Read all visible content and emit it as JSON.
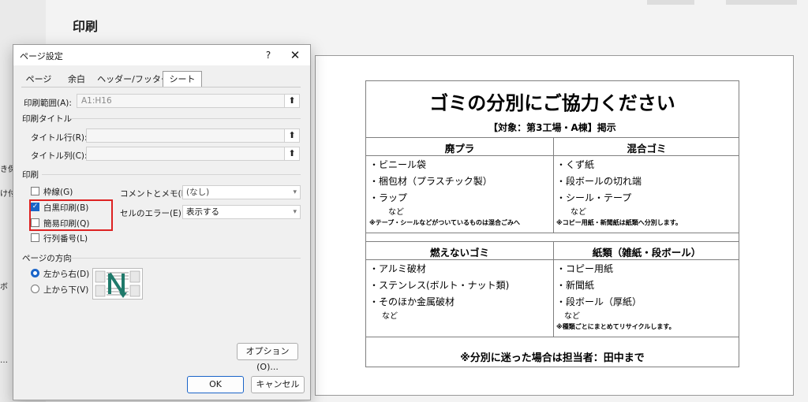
{
  "backstage": {
    "heading": "印刷",
    "edge_fragments": [
      "き保",
      "け付",
      "ボ",
      "…"
    ]
  },
  "dialog": {
    "title": "ページ設定",
    "help": "?",
    "close": "✕",
    "tabs": [
      "ページ",
      "余白",
      "ヘッダー/フッター",
      "シート"
    ],
    "active_tab": "シート",
    "print_area_label": "印刷範囲(A):",
    "print_area_value": "A1:H16",
    "print_titles_group": "印刷タイトル",
    "title_rows_label": "タイトル行(R):",
    "title_cols_label": "タイトル列(C):",
    "print_group": "印刷",
    "checkboxes": [
      {
        "label": "枠線(G)",
        "checked": false
      },
      {
        "label": "白黒印刷(B)",
        "checked": true
      },
      {
        "label": "簡易印刷(Q)",
        "checked": false
      },
      {
        "label": "行列番号(L)",
        "checked": false
      }
    ],
    "comments_label": "コメントとメモ(M):",
    "comments_value": "(なし)",
    "cell_errors_label": "セルのエラー(E):",
    "cell_errors_value": "表示する",
    "page_order_group": "ページの方向",
    "radio_down_then_over": "左から右(D)",
    "radio_over_then_down": "上から下(V)",
    "selected_order": "left_to_right",
    "options_button": "オプション(O)...",
    "ok_button": "OK",
    "cancel_button": "キャンセル",
    "accent_color": "#1a64c8",
    "highlight_color": "#dd2222",
    "up_arrow_icon": "⬆"
  },
  "sheet": {
    "title": "ゴミの分別にご協力ください",
    "subtitle": "【対象：第3工場・A棟】掲示",
    "categories": [
      {
        "name": "廃プラ",
        "items": [
          "・ビニール袋",
          "・梱包材（プラスチック製）",
          "・ラップ"
        ],
        "etc": "など",
        "note": "※テープ・シールなどがついているものは混合ごみへ"
      },
      {
        "name": "混合ゴミ",
        "items": [
          "・くず紙",
          "・段ボールの切れ端",
          "・シール・テープ"
        ],
        "etc": "など",
        "note": "※コピー用紙・新聞紙は紙類へ分別します。"
      },
      {
        "name": "燃えないゴミ",
        "items": [
          "・アルミ破材",
          "・ステンレス(ボルト・ナット類)",
          "・そのほか金属破材"
        ],
        "etc": "など",
        "note": ""
      },
      {
        "name": "紙類（雑紙・段ボール）",
        "items": [
          "・コピー用紙",
          "・新聞紙",
          "・段ボール（厚紙）"
        ],
        "etc": "など",
        "note": "※種類ごとにまとめてリサイクルします。"
      }
    ],
    "footer": "※分別に迷った場合は担当者：田中まで"
  }
}
